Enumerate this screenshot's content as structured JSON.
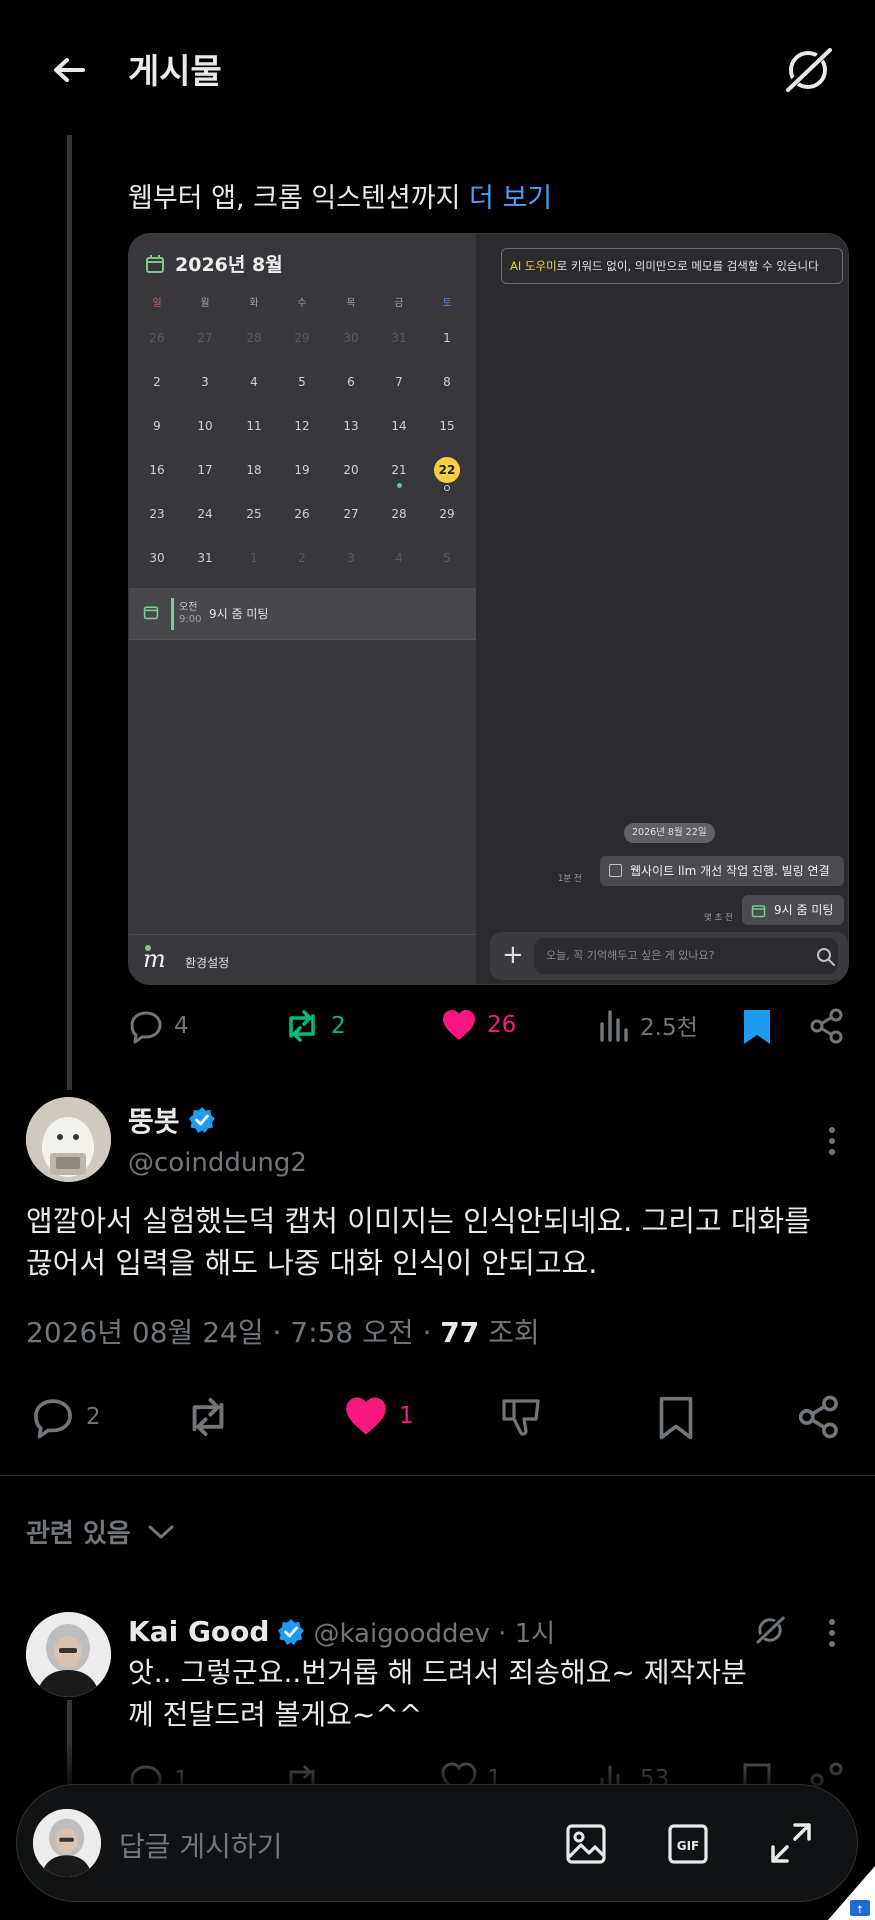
{
  "header": {
    "title": "게시물"
  },
  "parent_post": {
    "text_prefix": "웹부터 앱, 크롬 익스텐션까지",
    "more_link": "더 보기",
    "media": {
      "calendar_title": "2026년 8월",
      "weekdays": [
        "일",
        "월",
        "화",
        "수",
        "목",
        "금",
        "토"
      ],
      "weeks": [
        [
          "26",
          "27",
          "28",
          "29",
          "30",
          "31",
          "1"
        ],
        [
          "2",
          "3",
          "4",
          "5",
          "6",
          "7",
          "8"
        ],
        [
          "9",
          "10",
          "11",
          "12",
          "13",
          "14",
          "15"
        ],
        [
          "16",
          "17",
          "18",
          "19",
          "20",
          "21",
          "22"
        ],
        [
          "23",
          "24",
          "25",
          "26",
          "27",
          "28",
          "29"
        ],
        [
          "30",
          "31",
          "1",
          "2",
          "3",
          "4",
          "5"
        ]
      ],
      "event": {
        "ampm": "오전",
        "time": "9:00",
        "name": "9시 줌 미팅"
      },
      "settings_label": "환경설정",
      "logo_letter": "m",
      "ai_banner_highlight": "AI 도우미",
      "ai_banner_rest": "로 키워드 없이, 의미만으로 메모를 검색할 수 있습니다",
      "date_pill": "2026년 8월 22일",
      "msg1_time": "1분 전",
      "msg1_text": "웹사이트 llm 개선 작업 진행. 빌링 연결",
      "msg2_time": "몇 초 전",
      "msg2_text": "9시 줌 미팅",
      "input_placeholder": "오늘, 꼭 기억해두고 싶은 게 있나요?"
    },
    "stats": {
      "replies": "4",
      "reposts": "2",
      "likes": "26",
      "views": "2.5천"
    }
  },
  "reply_post": {
    "display_name": "뚱봇",
    "handle": "@coinddung2",
    "text": "앱깔아서 실험했는덕 캡처 이미지는  인식안되네요. 그리고 대화를 끊어서 입력을 해도 나중 대화 인식이 안되고요.",
    "date": "2026년 08월 24일 · 7:58 오전 · ",
    "views_count": "77",
    "views_label": " 조회",
    "replies": "2",
    "likes": "1"
  },
  "related": {
    "label": "관련 있음"
  },
  "kai_post": {
    "display_name": "Kai Good",
    "handle_time": "@kaigooddev · 1시",
    "text": "앗.. 그렇군요..번거롭 해 드려서 죄송해요~ 제작자분께 전달드려 볼게요~^^",
    "replies": "1",
    "likes": "1",
    "views": "53"
  },
  "composer": {
    "placeholder": "답글 게시하기"
  },
  "colors": {
    "background": "#000000",
    "repost": "#00ba7c",
    "like": "#f91880",
    "link": "#4a9ff5",
    "verified": "#1d9bf0",
    "bookmark": "#1d9bf0"
  }
}
